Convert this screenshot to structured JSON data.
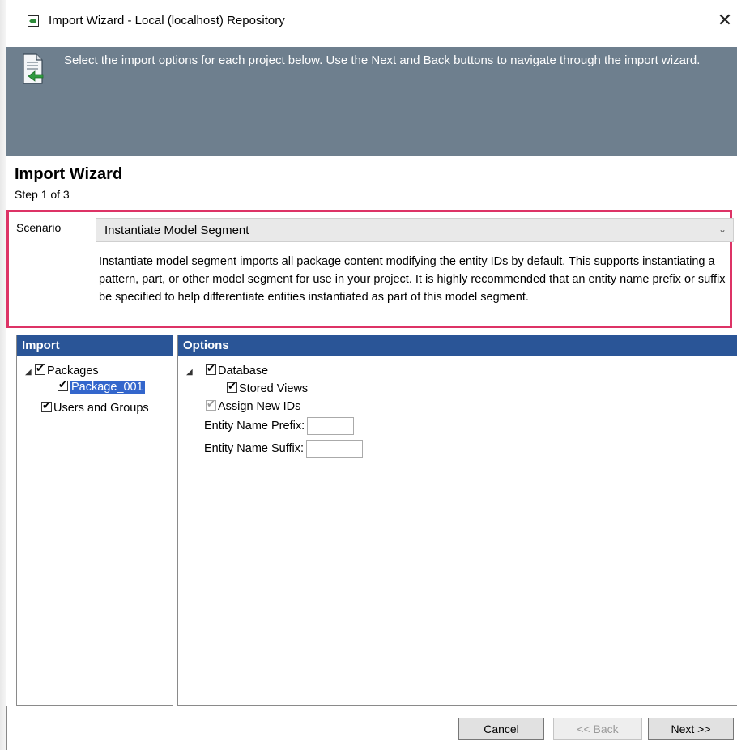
{
  "window": {
    "title": "Import Wizard - Local  (localhost) Repository",
    "close_glyph": "✕"
  },
  "banner": {
    "text": "Select the import options for each project below. Use the Next and Back buttons to navigate through the import wizard.",
    "icon": "document-import-icon"
  },
  "wizard": {
    "heading": "Import Wizard",
    "step": "Step 1 of 3"
  },
  "scenario": {
    "label": "Scenario",
    "selected": "Instantiate Model Segment",
    "description": "Instantiate model segment imports all package content modifying the entity IDs by default. This supports instantiating a pattern, part, or other model segment for use in your project. It is highly recommended that an entity name prefix or suffix be specified to help differentiate entities instantiated as part of this model segment."
  },
  "import_panel": {
    "header": "Import",
    "packages_label": "Packages",
    "package_item_label": "Package_001",
    "users_groups_label": "Users and Groups"
  },
  "options_panel": {
    "header": "Options",
    "database_label": "Database",
    "stored_views_label": "Stored Views",
    "assign_new_ids_label": "Assign New IDs",
    "prefix_label": "Entity Name Prefix:",
    "prefix_value": "",
    "suffix_label": "Entity Name Suffix:",
    "suffix_value": ""
  },
  "buttons": {
    "cancel": "Cancel",
    "back": "<< Back",
    "next": "Next >>"
  },
  "colors": {
    "banner": "#6e7f8e",
    "panel_header": "#2a5597",
    "highlight_border": "#dd3366",
    "selection": "#3366cc"
  }
}
